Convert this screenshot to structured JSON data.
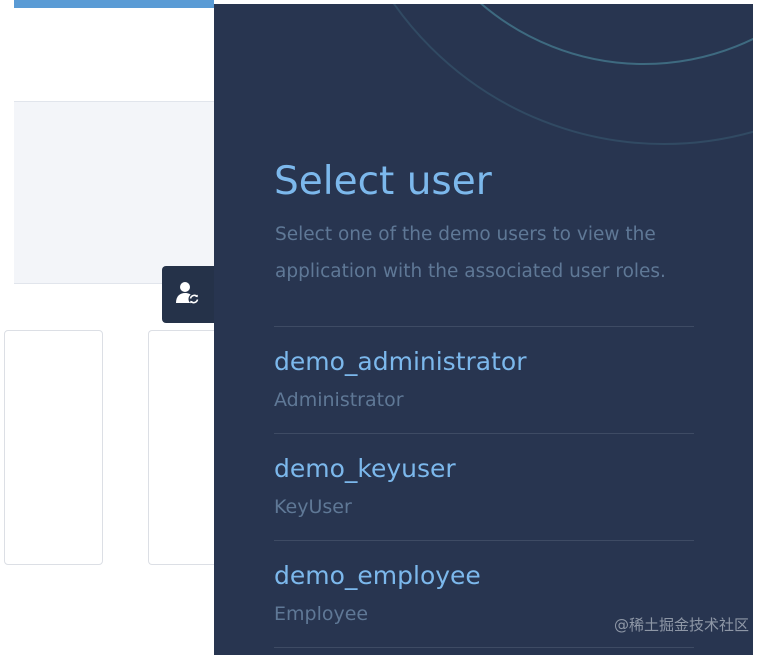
{
  "panel": {
    "title": "Select user",
    "description": "Select one of the demo users to view the application with the associated user roles.",
    "users": [
      {
        "username": "demo_administrator",
        "role": "Administrator"
      },
      {
        "username": "demo_keyuser",
        "role": "KeyUser"
      },
      {
        "username": "demo_employee",
        "role": "Employee"
      }
    ]
  },
  "tab": {
    "icon": "user-switch-icon"
  },
  "watermark": {
    "text": "@稀土掘金技术社区"
  },
  "colors": {
    "panel_bg": "#283550",
    "accent": "#7cb8ec",
    "muted": "#5f7896",
    "top_bar": "#5a9bd5"
  }
}
